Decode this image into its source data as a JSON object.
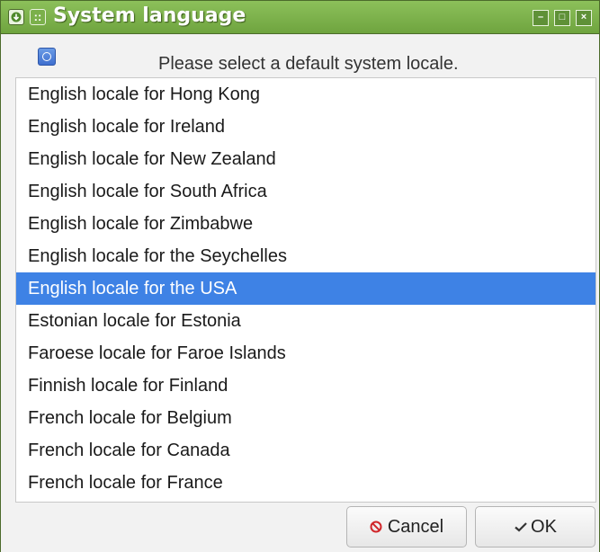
{
  "window": {
    "title": "System language",
    "left_icons": [
      "download-icon",
      "menu-grip-icon"
    ],
    "controls": [
      "minimize-icon",
      "maximize-icon",
      "close-icon"
    ],
    "title_glyphs": {
      "grip": "::",
      "minimize": "–",
      "maximize": "□",
      "close": "×"
    },
    "accent_color": "#7bb04b"
  },
  "header": {
    "icon": "globe-icon",
    "prompt": "Please select a default system locale."
  },
  "locales": {
    "selected_index": 6,
    "selection_color": "#3e82e5",
    "items": [
      "English locale for Hong Kong",
      "English locale for Ireland",
      "English locale for New Zealand",
      "English locale for South Africa",
      "English locale for Zimbabwe",
      "English locale for the Seychelles",
      "English locale for the USA",
      "Estonian locale for Estonia",
      "Faroese locale for Faroe Islands",
      "Finnish locale for Finland",
      "French locale for Belgium",
      "French locale for Canada",
      "French locale for France"
    ]
  },
  "buttons": {
    "cancel_label": "Cancel",
    "cancel_icon": "cancel-icon",
    "ok_label": "OK",
    "ok_icon": "checkmark-icon"
  }
}
